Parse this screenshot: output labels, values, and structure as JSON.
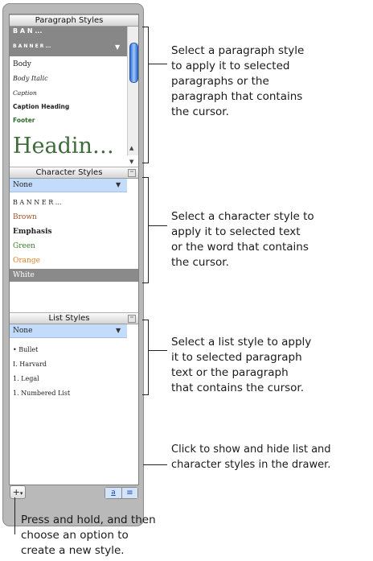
{
  "paragraph_styles": {
    "header": "Paragraph Styles",
    "items": [
      "B  A  N  ...",
      "B  A  N  N  E  R  ...",
      "Body",
      "Body Italic",
      "Caption",
      "Caption Heading",
      "Footer",
      "Headin…"
    ]
  },
  "character_styles": {
    "header": "Character Styles",
    "selected": "None",
    "items": [
      "B  A  N  N  E  R  ...",
      "Brown",
      "Emphasis",
      "Green",
      "Orange",
      "White"
    ]
  },
  "list_styles": {
    "header": "List Styles",
    "selected": "None",
    "items": [
      "• Bullet",
      "I. Harvard",
      "1. Legal",
      "1. Numbered List"
    ]
  },
  "callouts": {
    "paragraph": [
      "Select a paragraph style",
      "to apply it to selected",
      "paragraphs or the",
      "paragraph that contains",
      "the cursor."
    ],
    "character": [
      "Select a character style to",
      "apply it to selected text",
      "or the word that contains",
      "the cursor."
    ],
    "list": [
      "Select a list style to apply",
      "it to selected paragraph",
      "text or the paragraph",
      "that contains the cursor."
    ],
    "drawer": [
      "Click to show and hide list and",
      "character styles in the drawer."
    ],
    "new_style": [
      "Press and hold, and then",
      "choose an option to",
      "create a new style."
    ]
  },
  "colors": {
    "brown": "#a0522d",
    "green": "#3d7a2a",
    "orange": "#e0802a",
    "heading": "#3d6b3a",
    "footer": "#2e6b2e",
    "selection": "#c4dcfb"
  },
  "icons": {
    "add": "plus-icon",
    "toggle": "list-toggle-icon"
  }
}
